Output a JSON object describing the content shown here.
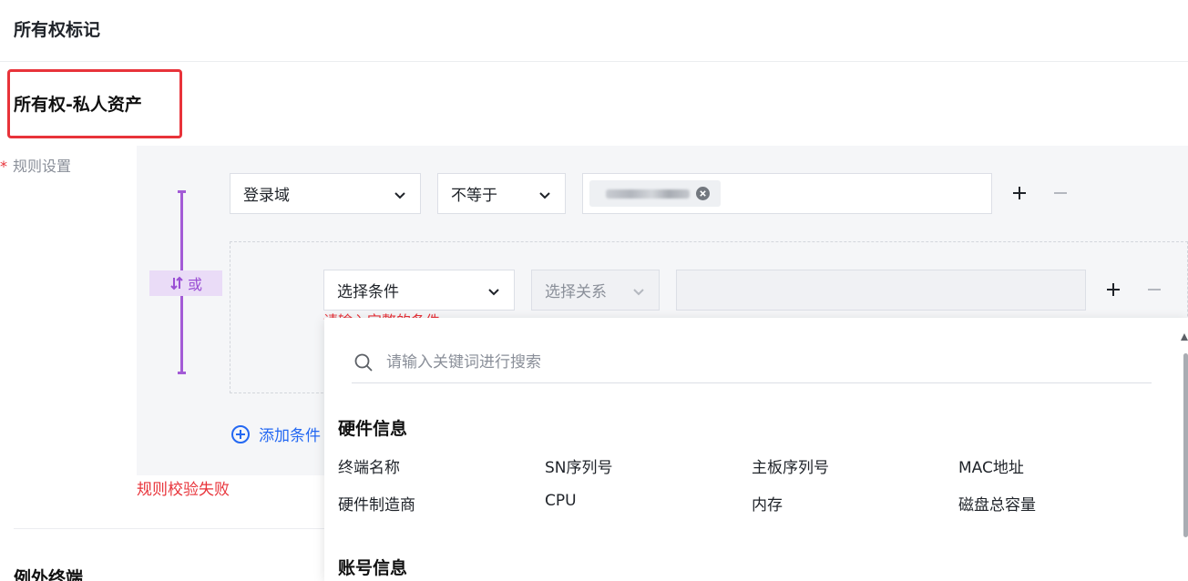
{
  "page": {
    "title": "所有权标记"
  },
  "section": {
    "title": "所有权-私人资产"
  },
  "rule": {
    "label": "规则设置",
    "required_mark": "*",
    "logic_toggle": "或",
    "row1": {
      "field": "登录域",
      "operator": "不等于",
      "tag_value_obscured": true
    },
    "row2": {
      "field_placeholder": "选择条件",
      "operator_placeholder": "选择关系",
      "error": "请输入完整的条件"
    },
    "add_condition": "添加条件",
    "validation_error": "规则校验失败"
  },
  "exception": {
    "title": "例外终端"
  },
  "dropdown": {
    "search_placeholder": "请输入关键词进行搜索",
    "categories": [
      {
        "title": "硬件信息",
        "options": [
          "终端名称",
          "SN序列号",
          "主板序列号",
          "MAC地址",
          "硬件制造商",
          "CPU",
          "内存",
          "磁盘总容量"
        ]
      },
      {
        "title": "账号信息",
        "options": []
      }
    ]
  },
  "colors": {
    "accent_purple": "#a35bd6",
    "error_red": "#e8333a",
    "link_blue": "#2468f2"
  },
  "icons": [
    "chevron-down-icon",
    "swap-icon",
    "close-circle-icon",
    "plus-icon",
    "minus-icon",
    "add-circle-icon",
    "search-icon"
  ]
}
